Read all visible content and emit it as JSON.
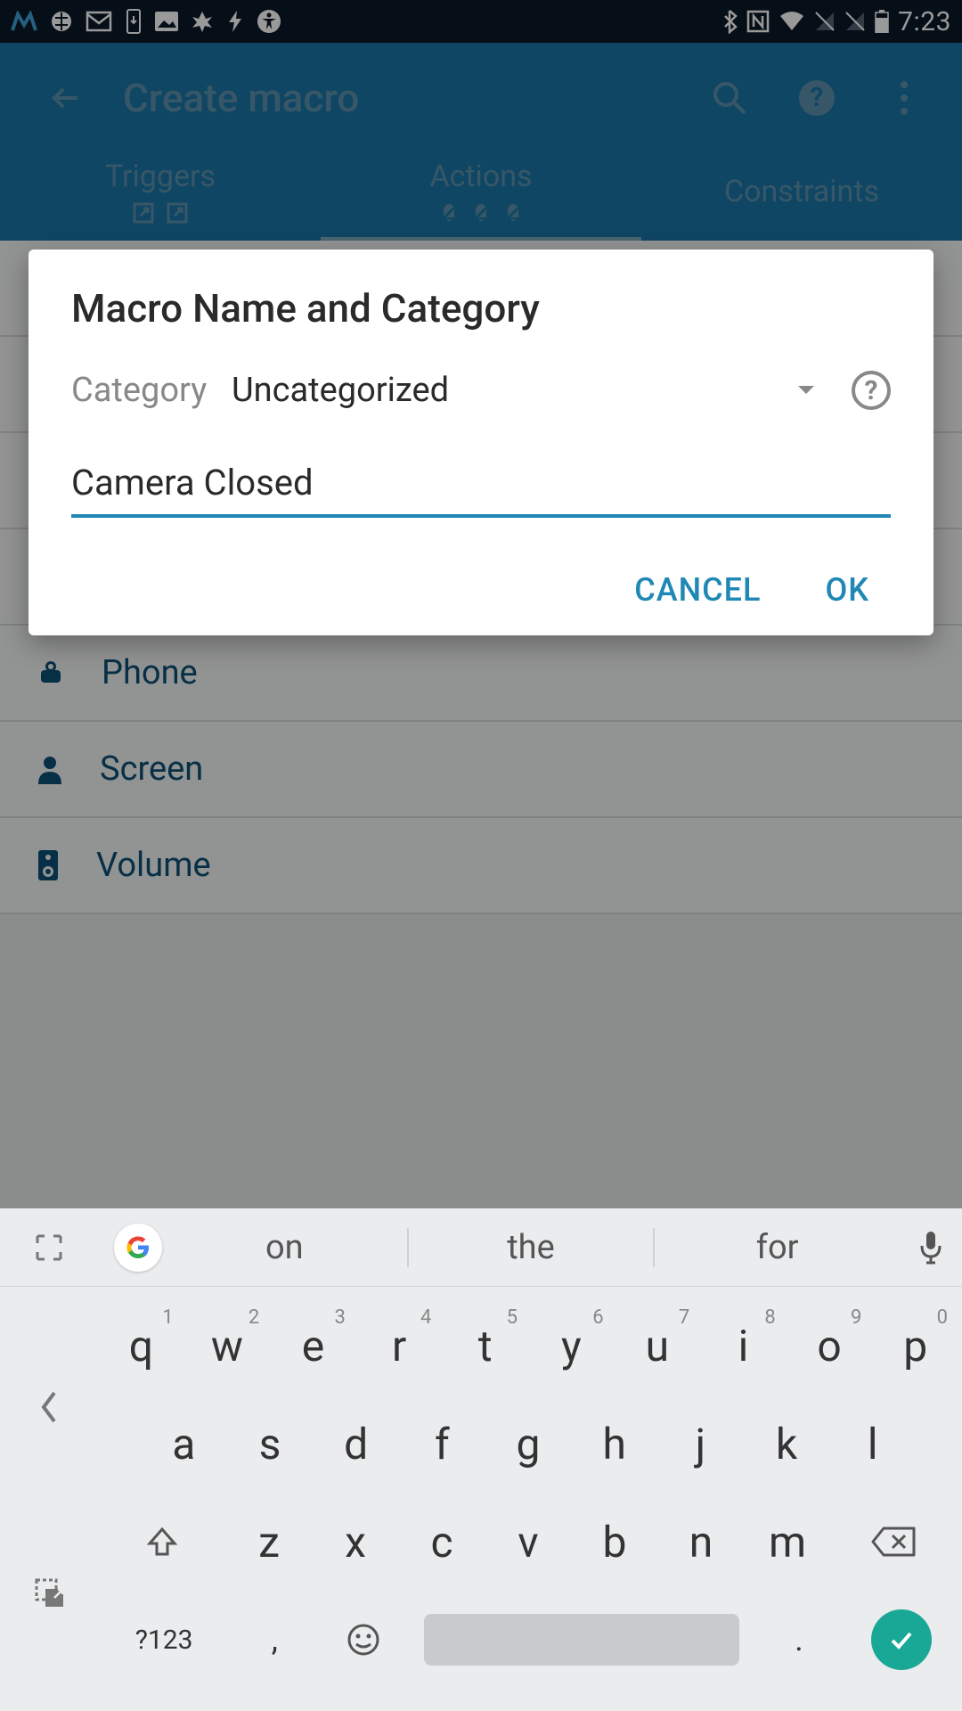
{
  "status": {
    "time": "7:23"
  },
  "appbar": {
    "title": "Create macro"
  },
  "tabs": {
    "triggers": "Triggers",
    "actions": "Actions",
    "constraints": "Constraints"
  },
  "list": {
    "phone": "Phone",
    "screen": "Screen",
    "volume": "Volume"
  },
  "dialog": {
    "title": "Macro Name and Category",
    "category_label": "Category",
    "category_value": "Uncategorized",
    "name_value": "Camera Closed",
    "cancel": "CANCEL",
    "ok": "OK"
  },
  "keyboard": {
    "suggest1": "on",
    "suggest2": "the",
    "suggest3": "for",
    "row1": [
      "q",
      "w",
      "e",
      "r",
      "t",
      "y",
      "u",
      "i",
      "o",
      "p"
    ],
    "row1_hints": [
      "1",
      "2",
      "3",
      "4",
      "5",
      "6",
      "7",
      "8",
      "9",
      "0"
    ],
    "row2": [
      "a",
      "s",
      "d",
      "f",
      "g",
      "h",
      "j",
      "k",
      "l"
    ],
    "row3": [
      "z",
      "x",
      "c",
      "v",
      "b",
      "n",
      "m"
    ],
    "sym": "?123",
    "comma": ",",
    "period": "."
  }
}
